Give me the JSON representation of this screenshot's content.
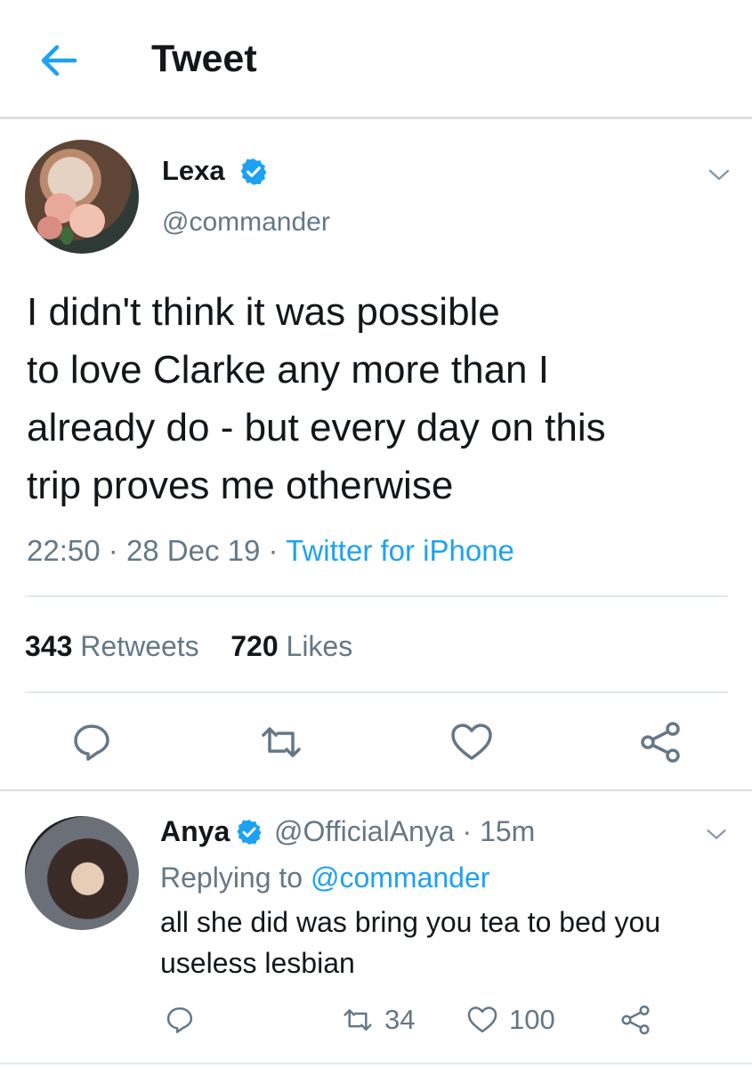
{
  "header": {
    "title": "Tweet"
  },
  "tweet": {
    "display_name": "Lexa",
    "handle": "@commander",
    "text_lines": [
      "I didn't think it was possible",
      "to love Clarke any more than I",
      "already do - but every day on this",
      "trip proves me otherwise"
    ],
    "time": "22:50",
    "date": "28 Dec 19",
    "separator": "·",
    "source": "Twitter for iPhone",
    "retweets_count": "343",
    "retweets_label": "Retweets",
    "likes_count": "720",
    "likes_label": "Likes"
  },
  "reply": {
    "display_name": "Anya",
    "handle": "@OfficialAnya",
    "time_ago": "15m",
    "replying_prefix": "Replying to",
    "replying_to": "@commander",
    "text_lines": [
      "all she did was bring you tea to bed you",
      "useless lesbian"
    ],
    "retweets": "34",
    "likes": "100"
  },
  "colors": {
    "accent": "#1da1f2",
    "secondary": "#657786",
    "text": "#14171a",
    "divider": "#e1e8ed"
  },
  "icons": [
    "back-arrow-icon",
    "verified-badge-icon",
    "chevron-down-icon",
    "reply-icon",
    "retweet-icon",
    "like-icon",
    "share-icon"
  ]
}
